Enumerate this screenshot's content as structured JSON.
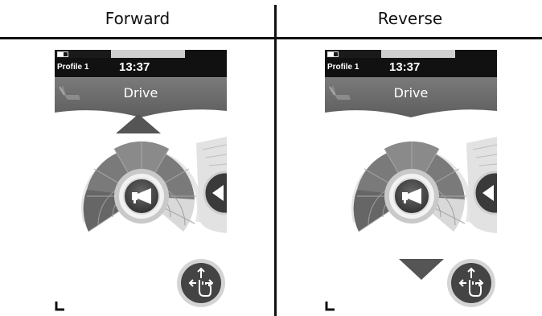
{
  "columns": [
    {
      "header": "Forward"
    },
    {
      "header": "Reverse"
    }
  ],
  "screen": {
    "profile_label": "Profile 1",
    "time": "13:37",
    "mode_label": "Drive"
  },
  "icons": {
    "horn": "horn-icon",
    "seat": "seat-icon",
    "touch": "touch-move-icon",
    "forward_indicator": "arrow-up-icon",
    "reverse_indicator": "arrow-down-icon"
  },
  "colors": {
    "status_bar": "#111111",
    "mode_bar": "#6b6b6b",
    "dial_dark": "#6e6e6e",
    "dial_light": "#d9d9d9",
    "arrow": "#555555"
  },
  "speed_dial": {
    "forward": {
      "direction": "forward",
      "shaded_segments": 8
    },
    "reverse": {
      "direction": "reverse",
      "shaded_segments": 8
    }
  }
}
